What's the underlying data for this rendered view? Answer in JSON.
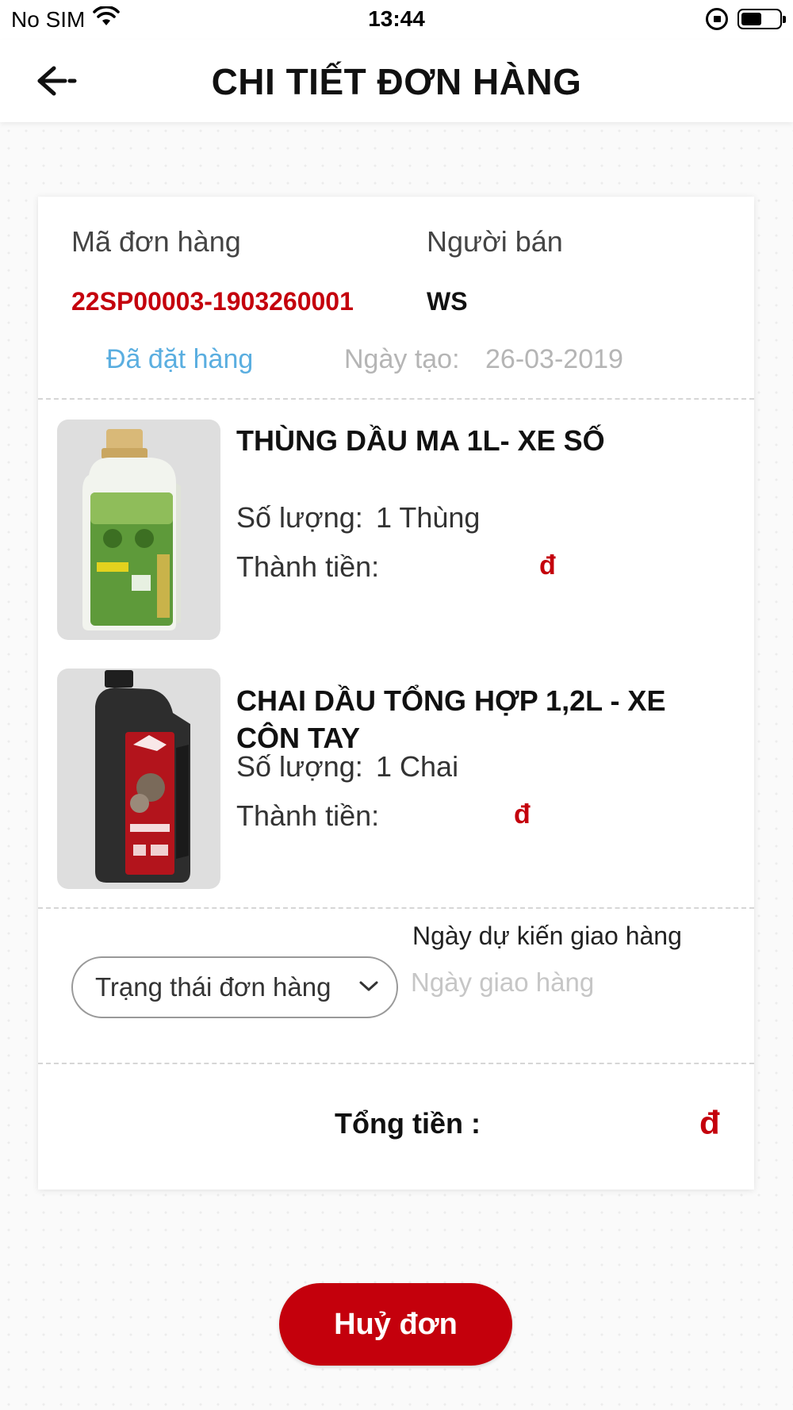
{
  "status_bar": {
    "carrier": "No SIM",
    "time": "13:44",
    "icons": [
      "wifi-icon",
      "rotation-lock-icon",
      "battery-icon"
    ]
  },
  "header": {
    "title": "CHI TIẾT ĐƠN HÀNG",
    "back_icon": "back-arrow-icon"
  },
  "order": {
    "code_label": "Mã đơn hàng",
    "code_value": "22SP00003-1903260001",
    "seller_label": "Người bán",
    "seller_value": "WS",
    "status": "Đã đặt hàng",
    "created_label": "Ngày tạo:",
    "created_value": "26-03-2019"
  },
  "items": [
    {
      "name": "THÙNG DẦU MA 1L- XE SỐ",
      "qty_label": "Số lượng:",
      "qty_value": "1 Thùng",
      "price_label": "Thành tiền:",
      "price_value": "đ",
      "image_icon": "oil-bottle-green-image"
    },
    {
      "name": "CHAI DẦU TỔNG HỢP 1,2L - XE CÔN TAY",
      "qty_label": "Số lượng:",
      "qty_value": "1 Chai",
      "price_label": "Thành tiền:",
      "price_value": "đ",
      "image_icon": "oil-bottle-black-image"
    }
  ],
  "delivery": {
    "status_select_value": "Trạng thái đơn hàng",
    "expected_label": "Ngày dự kiến giao hàng",
    "date_placeholder": "Ngày giao hàng"
  },
  "total": {
    "label": "Tổng tiền :",
    "value": "đ"
  },
  "actions": {
    "cancel_label": "Huỷ đơn"
  },
  "colors": {
    "accent_red": "#c4000c",
    "status_blue": "#5aaee0"
  }
}
